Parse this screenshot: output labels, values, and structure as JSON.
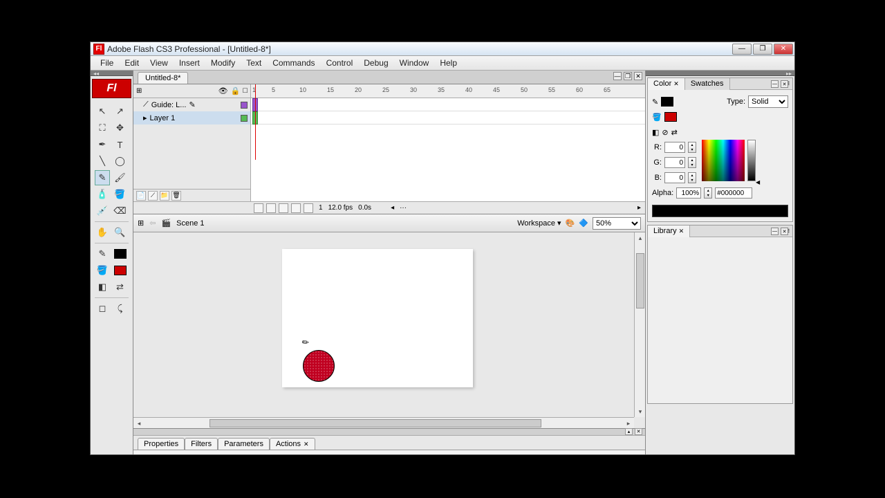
{
  "titlebar": {
    "app_icon": "Fl",
    "title": "Adobe Flash CS3 Professional - [Untitled-8*]"
  },
  "menubar": [
    "File",
    "Edit",
    "View",
    "Insert",
    "Modify",
    "Text",
    "Commands",
    "Control",
    "Debug",
    "Window",
    "Help"
  ],
  "toolbox": {
    "logo": "Fl"
  },
  "document": {
    "tab": "Untitled-8*",
    "scene": "Scene 1",
    "workspace_label": "Workspace ▾",
    "zoom": "50%"
  },
  "timeline": {
    "layers": [
      {
        "name": "Guide: L..."
      },
      {
        "name": "Layer 1"
      }
    ],
    "ruler_marks": [
      "1",
      "5",
      "10",
      "15",
      "20",
      "25",
      "30",
      "35",
      "40",
      "45",
      "50",
      "55",
      "60",
      "65"
    ],
    "status": {
      "frame": "1",
      "fps": "12.0 fps",
      "time": "0.0s"
    }
  },
  "bottom_dock": {
    "tabs": [
      "Properties",
      "Filters",
      "Parameters",
      "Actions"
    ]
  },
  "right_dock": {
    "color": {
      "tabs": [
        "Color",
        "Swatches"
      ],
      "type_label": "Type:",
      "type_value": "Solid",
      "r": "0",
      "g": "0",
      "b": "0",
      "alpha_label": "Alpha:",
      "alpha": "100%",
      "hex": "#000000",
      "stroke_swatch": "#000000",
      "fill_swatch": "#cc0000"
    },
    "library": {
      "tab": "Library"
    }
  }
}
